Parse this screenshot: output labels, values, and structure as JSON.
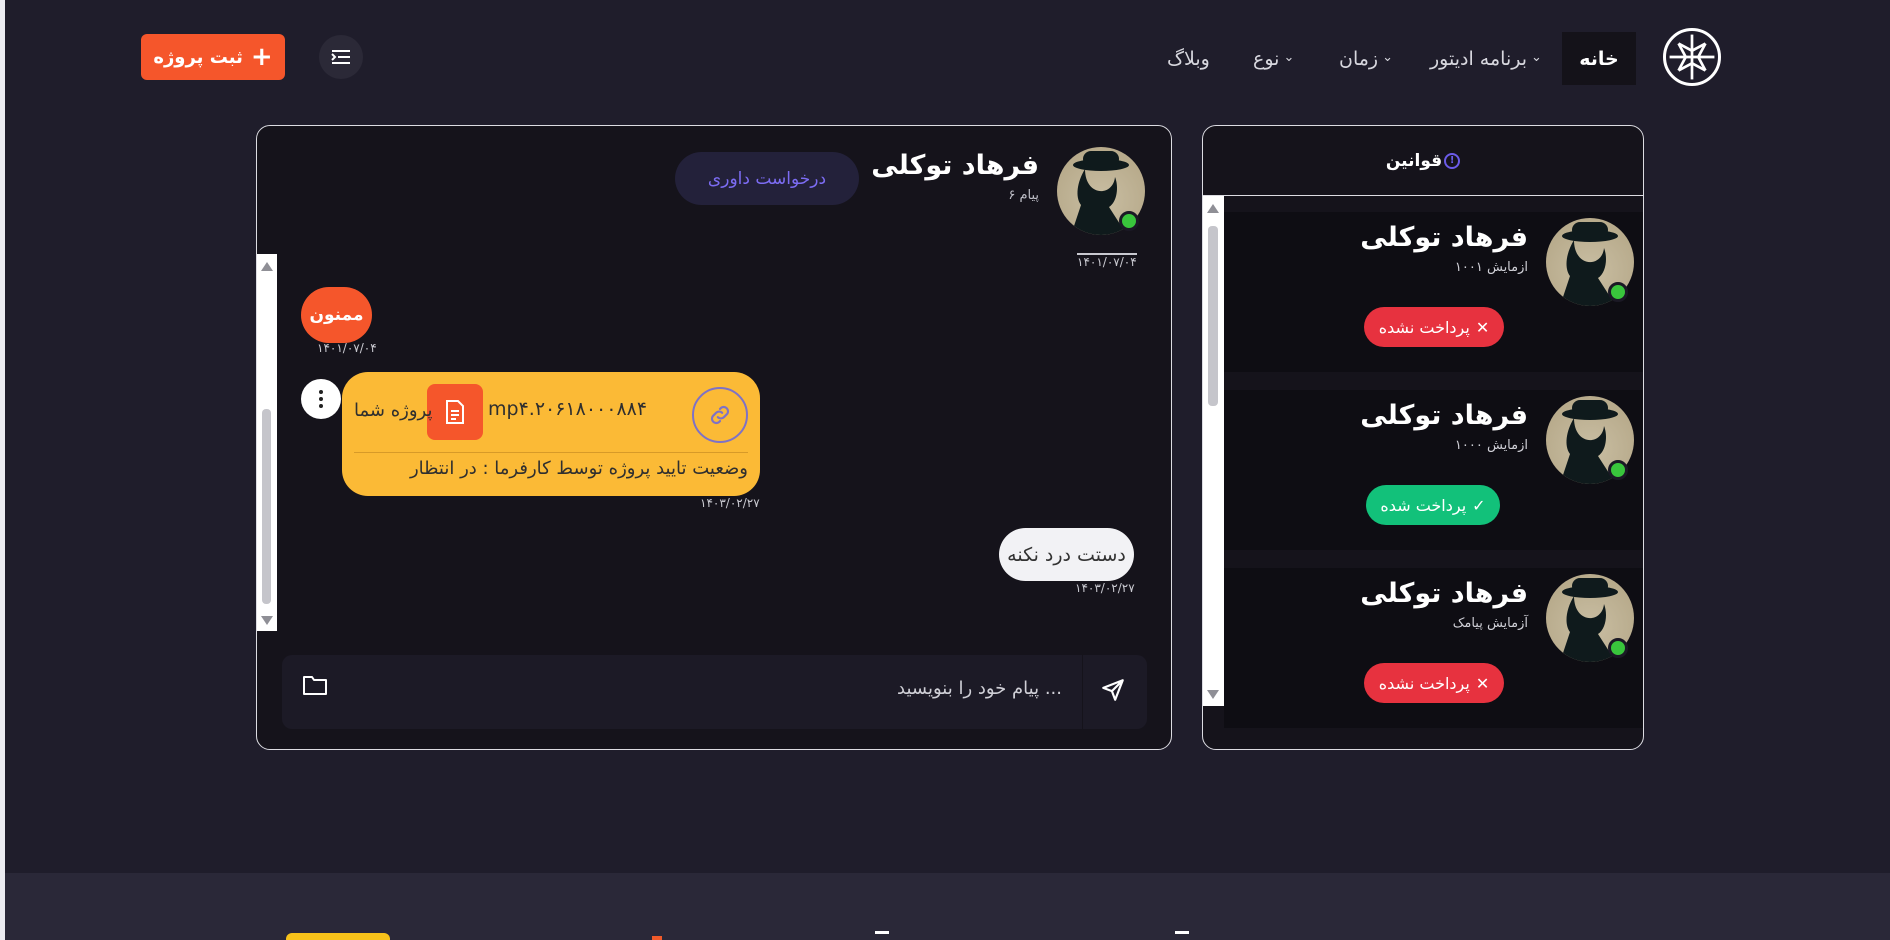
{
  "header": {
    "nav": {
      "home": "خانه",
      "editor_program": "برنامه ادیتور",
      "time": "زمان",
      "type": "نوع",
      "blog": "وبلاگ"
    },
    "submit_project": "ثبت پروژه"
  },
  "chat": {
    "user_name": "فرهاد توکلی",
    "message_count": "۶ پیام",
    "arbitration_button": "درخواست داوری",
    "messages": [
      {
        "text": "",
        "date": "۱۴۰۱/۰۷/۰۴"
      },
      {
        "text": "ممنون",
        "date": "۱۴۰۱/۰۷/۰۴"
      },
      {
        "file_name": "mp۴.۲۰۶۱۸۰۰۰۸۸۴",
        "file_label": "پروژه شما",
        "status": "وضعیت تایید پروژه توسط کارفرما : در انتظار",
        "date": "۱۴۰۳/۰۲/۲۷"
      },
      {
        "text": "دستت درد نکنه",
        "date": "۱۴۰۳/۰۲/۲۷"
      }
    ],
    "input_placeholder": "پیام خود را بنویسید ..."
  },
  "projects": {
    "rules_label": "قوانین",
    "items": [
      {
        "name": "فرهاد توکلی",
        "subtitle": "ازمایش ۱۰۰۱",
        "status": "پرداخت نشده",
        "paid": false
      },
      {
        "name": "فرهاد توکلی",
        "subtitle": "ازمایش ۱۰۰۰",
        "status": "پرداخت شده",
        "paid": true
      },
      {
        "name": "فرهاد توکلی",
        "subtitle": "آزمایش پیامک",
        "status": "پرداخت نشده",
        "paid": false
      }
    ]
  },
  "colors": {
    "background": "#1f1d2b",
    "accent": "#f5562b",
    "file_card": "#fbba36",
    "paid": "#12c17a",
    "unpaid": "#e7323f",
    "online": "#39c53c"
  }
}
